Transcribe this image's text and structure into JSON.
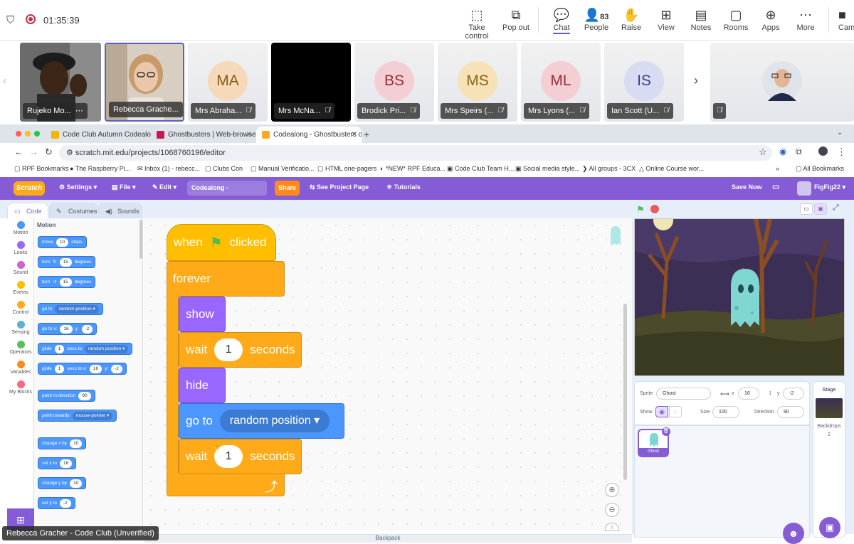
{
  "teams": {
    "timer": "01:35:39",
    "buttons": [
      {
        "label": "Take control",
        "icon": "take-control-icon"
      },
      {
        "label": "Pop out",
        "icon": "pop-out-icon"
      },
      {
        "label": "Chat",
        "icon": "chat-icon"
      },
      {
        "label": "People",
        "icon": "people-icon",
        "count": "83"
      },
      {
        "label": "Raise",
        "icon": "raise-hand-icon"
      },
      {
        "label": "View",
        "icon": "view-icon"
      },
      {
        "label": "Notes",
        "icon": "notes-icon"
      },
      {
        "label": "Rooms",
        "icon": "rooms-icon"
      },
      {
        "label": "Apps",
        "icon": "apps-icon"
      },
      {
        "label": "More",
        "icon": "more-icon"
      },
      {
        "label": "Cam",
        "icon": "camera-icon"
      }
    ],
    "active_button": "Chat"
  },
  "participants": [
    {
      "name": "Rujeko Mo...",
      "initials": "",
      "video": true
    },
    {
      "name": "Rebecca Grache...",
      "initials": "",
      "video": true
    },
    {
      "name": "Mrs Abraha...",
      "initials": "MA",
      "color": "#f5d9b8"
    },
    {
      "name": "Mrs McNa...",
      "initials": "",
      "color": "#000000"
    },
    {
      "name": "Brodick Pri...",
      "initials": "BS",
      "color": "#f3cfd4"
    },
    {
      "name": "Mrs Speirs (...",
      "initials": "MS",
      "color": "#f6e2b6"
    },
    {
      "name": "Mrs Lyons (...",
      "initials": "ML",
      "color": "#f3cfd4"
    },
    {
      "name": "Ian Scott (U...",
      "initials": "IS",
      "color": "#d9dbf2"
    }
  ],
  "browser": {
    "tabs": [
      {
        "title": "Code Club Autumn Codealong",
        "fav": "#f4b400"
      },
      {
        "title": "Ghostbusters | Web-browser",
        "fav": "#c51a4a"
      },
      {
        "title": "Codealong - Ghostbusters on",
        "fav": "#f9a825"
      }
    ],
    "url": "scratch.mit.edu/projects/1068760196/editor",
    "bookmarks": [
      "RPF Bookmarks",
      "The Raspberry Pi...",
      "Inbox (1) - rebecc...",
      "Clubs Con",
      "Manual Verificatio...",
      "HTML one-pagers",
      "*NEW* RPF Educa...",
      "Code Club Team H...",
      "Social media style...",
      "All groups - 3CX",
      "Online Course wor...",
      "All Bookmarks"
    ]
  },
  "scratch": {
    "logo": "Scratch",
    "menu": {
      "settings": "Settings",
      "file": "File",
      "edit": "Edit",
      "project_title": "Codealong - Ghostbusters",
      "share": "Share",
      "see_project": "See Project Page",
      "tutorials": "Tutorials",
      "save_now": "Save Now",
      "user": "FigFig22"
    },
    "tabs": [
      "Code",
      "Costumes",
      "Sounds"
    ],
    "categories": [
      {
        "label": "Motion",
        "color": "#4c97ff"
      },
      {
        "label": "Looks",
        "color": "#9966ff"
      },
      {
        "label": "Sound",
        "color": "#cf63cf"
      },
      {
        "label": "Events",
        "color": "#ffbf00"
      },
      {
        "label": "Control",
        "color": "#ffab19"
      },
      {
        "label": "Sensing",
        "color": "#5cb1d6"
      },
      {
        "label": "Operators",
        "color": "#59c059"
      },
      {
        "label": "Variables",
        "color": "#ff8c1a"
      },
      {
        "label": "My Blocks",
        "color": "#ff6680"
      }
    ],
    "palette_heading": "Motion",
    "palette": {
      "move": [
        "move",
        "10",
        "steps"
      ],
      "turn_right": [
        "turn",
        "15",
        "degrees"
      ],
      "turn_left": [
        "turn",
        "15",
        "degrees"
      ],
      "goto": [
        "go to",
        "random position"
      ],
      "gotoxy": [
        "go to x:",
        "16",
        "y:",
        "-2"
      ],
      "glide": [
        "glide",
        "1",
        "secs to",
        "random position"
      ],
      "glidexy": [
        "glide",
        "1",
        "secs to x:",
        "16",
        "y:",
        "-2"
      ],
      "point_dir": [
        "point in direction",
        "90"
      ],
      "point_towards": [
        "point towards",
        "mouse-pointer"
      ],
      "change_x": [
        "change x by",
        "10"
      ],
      "set_x": [
        "set x to",
        "16"
      ],
      "change_y": [
        "change y by",
        "10"
      ],
      "set_y": [
        "set y to",
        "-2"
      ]
    },
    "script": {
      "hat": [
        "when",
        "clicked"
      ],
      "forever": "forever",
      "show": "show",
      "wait1": [
        "wait",
        "1",
        "seconds"
      ],
      "hide": "hide",
      "goto": [
        "go to",
        "random position"
      ],
      "wait2": [
        "wait",
        "1",
        "seconds"
      ]
    },
    "sprite": {
      "label": "Sprite",
      "name": "Ghost",
      "x_label": "x",
      "x": "16",
      "y_label": "y",
      "y": "-2",
      "show_label": "Show",
      "size_label": "Size",
      "size": "100",
      "direction_label": "Direction",
      "direction": "90"
    },
    "sprite_thumb": "Ghost",
    "stage": {
      "label": "Stage",
      "backdrops_label": "Backdrops",
      "backdrops": "2"
    },
    "backpack": "Backpack"
  },
  "presenter_label": "Rebecca Gracher - Code Club (Unverified)"
}
